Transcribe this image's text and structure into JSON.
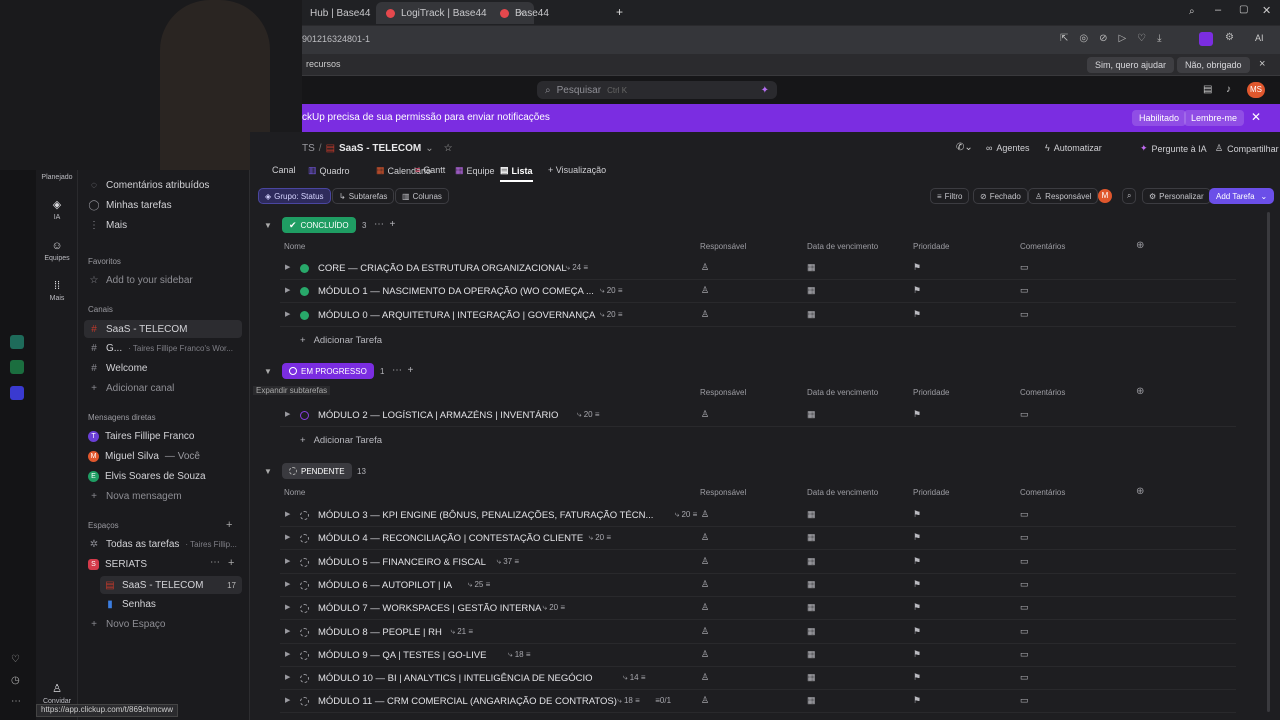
{
  "browser": {
    "tabs": [
      {
        "label": "Hub | Base44",
        "active": false
      },
      {
        "label": "LogiTrack | Base44",
        "active": true
      },
      {
        "label": "Base44",
        "active": false
      }
    ],
    "url": "901216324801-1",
    "infobar_text": "recursos",
    "infobar_btn1": "Sim, quero ajudar",
    "infobar_btn2": "Não, obrigado"
  },
  "app": {
    "search_placeholder": "Pesquisar",
    "search_shortcut": "Ctrl K",
    "user_initials": "MS"
  },
  "notification": {
    "message": "ckUp precisa de sua permissão para enviar notificações",
    "enable": "Habilitado",
    "remind": "Lembre-me"
  },
  "rail": {
    "planejado": "Planejado",
    "ia": "IA",
    "equipes": "Equipes",
    "mais": "Mais",
    "convidar": "Convidar"
  },
  "sidebar": {
    "top": [
      "Comentários atribuídos",
      "Minhas tarefas",
      "Mais"
    ],
    "favoritos": "Favoritos",
    "add_sidebar": "Add to your sidebar",
    "canais": "Canais",
    "canal_saas": "SaaS - TELECOM",
    "canal_g": "G...",
    "canal_g_sub": "· Taires Fillipe Franco's Wor...",
    "canal_welcome": "Welcome",
    "add_canal": "Adicionar canal",
    "msgs": "Mensagens diretas",
    "dm1": "Taires Fillipe Franco",
    "dm2": "Miguel Silva",
    "dm2_sub": "— Você",
    "dm3": "Elvis Soares de Souza",
    "nova_msg": "Nova mensagem",
    "espacos": "Espaços",
    "todas": "Todas as tarefas",
    "todas_sub": "· Taires Fillip...",
    "seriats": "SERIATS",
    "space_saas": "SaaS - TELECOM",
    "space_saas_count": "17",
    "senhas": "Senhas",
    "novo_espaco": "Novo Espaço",
    "status_url": "https://app.clickup.com/t/869chmcww"
  },
  "header": {
    "crumb_prefix": "TS",
    "crumb_title": "SaaS - TELECOM",
    "agentes": "Agentes",
    "automatizar": "Automatizar",
    "pergunte": "Pergunte à IA",
    "compartilhar": "Compartilhar",
    "views": [
      "Canal",
      "Quadro",
      "Calendário",
      "Gantt",
      "Equipe",
      "Lista",
      "+ Visualização"
    ]
  },
  "toolbar": {
    "grupo": "Grupo: Status",
    "subtarefas": "Subtarefas",
    "colunas": "Colunas",
    "filtro": "Filtro",
    "fechado": "Fechado",
    "responsavel": "Responsável",
    "personalizar": "Personalizar",
    "add_tarefa": "Add Tarefa"
  },
  "columns": {
    "nome": "Nome",
    "responsavel": "Responsável",
    "data": "Data de vencimento",
    "prioridade": "Prioridade",
    "comentarios": "Comentários"
  },
  "groups": {
    "concluido": {
      "label": "CONCLUÍDO",
      "count": "3",
      "color": "#1f9d63"
    },
    "progresso": {
      "label": "EM PROGRESSO",
      "count": "1",
      "color": "#7b2de1"
    },
    "pendente": {
      "label": "PENDENTE",
      "count": "13",
      "color": "#3a3a3f"
    }
  },
  "tooltip": "Expandir subtarefas",
  "add_task": "Adicionar Tarefa",
  "tasks_done": [
    {
      "name": "CORE — CRIAÇÃO DA ESTRUTURA ORGANIZACIONAL",
      "sub": "24"
    },
    {
      "name": "MÓDULO 1 — NASCIMENTO DA OPERAÇÃO (WO COMEÇA ...",
      "sub": "20"
    },
    {
      "name": "MÓDULO 0 — ARQUITETURA | INTEGRAÇÃO | GOVERNANÇA",
      "sub": "20"
    }
  ],
  "tasks_progress": [
    {
      "name": "MÓDULO 2 — LOGÍSTICA | ARMAZÉNS | INVENTÁRIO",
      "sub": "20"
    }
  ],
  "tasks_pending": [
    {
      "name": "MÓDULO 3 — KPI ENGINE (BÔNUS, PENALIZAÇÕES, FATURAÇÃO TÉCN...",
      "sub": "20"
    },
    {
      "name": "MÓDULO 4 — RECONCILIAÇÃO | CONTESTAÇÃO CLIENTE",
      "sub": "20"
    },
    {
      "name": "MÓDULO 5 — FINANCEIRO & FISCAL",
      "sub": "37"
    },
    {
      "name": "MÓDULO 6 — AUTOPILOT | IA",
      "sub": "25"
    },
    {
      "name": "MÓDULO 7 — WORKSPACES | GESTÃO INTERNA",
      "sub": "20"
    },
    {
      "name": "MÓDULO 8 — PEOPLE | RH",
      "sub": "21"
    },
    {
      "name": "MÓDULO 9 — QA | TESTES | GO-LIVE",
      "sub": "18"
    },
    {
      "name": "MÓDULO 10 — BI | ANALYTICS | INTELIGÊNCIA DE NEGÓCIO",
      "sub": "14"
    },
    {
      "name": "MÓDULO 11 — CRM COMERCIAL (ANGARIAÇÃO DE CONTRATOS)",
      "sub": "18",
      "extra": "0/1"
    }
  ]
}
